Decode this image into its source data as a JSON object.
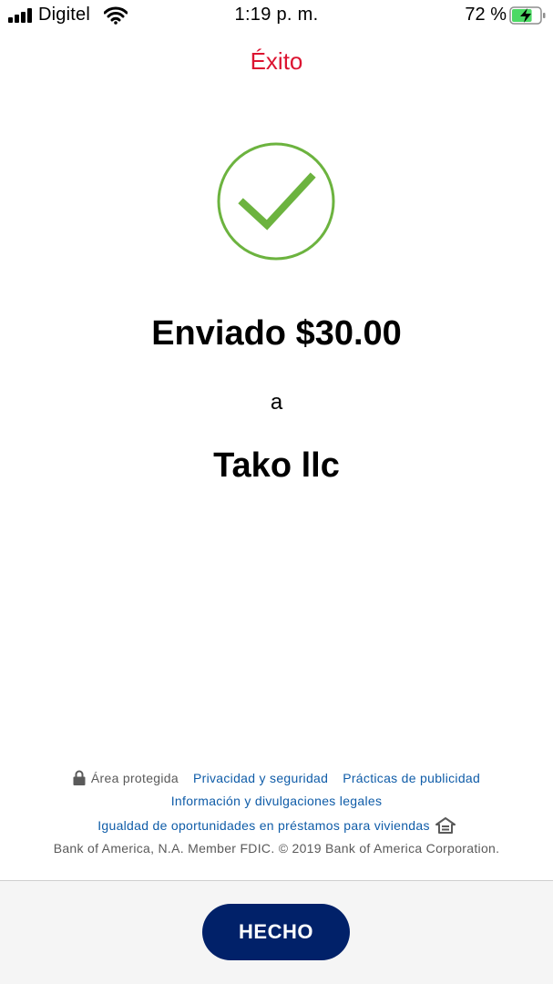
{
  "status_bar": {
    "carrier": "Digitel",
    "time": "1:19 p. m.",
    "battery_percent": "72 %",
    "battery_level": 0.72,
    "icons": [
      "signal-icon",
      "wifi-icon",
      "battery-charging-icon"
    ]
  },
  "header": {
    "title": "Éxito"
  },
  "confirmation": {
    "icon": "checkmark-circle-icon",
    "sent_text": "Enviado $30.00",
    "connector": "a",
    "recipient": "Tako llc"
  },
  "footer": {
    "secure_area": "Área protegida",
    "privacy_link": "Privacidad y seguridad",
    "advertising_link": "Prácticas de publicidad",
    "legal_link": "Información y divulgaciones legales",
    "equal_housing_link": "Igualdad de oportunidades en préstamos para viviendas",
    "copyright": "Bank of America, N.A. Member FDIC. © 2019 Bank of America Corporation."
  },
  "actions": {
    "done_label": "HECHO"
  },
  "colors": {
    "title_red": "#dc1431",
    "check_green": "#6cb33f",
    "link_blue": "#0f5ca8",
    "button_navy": "#012169"
  }
}
